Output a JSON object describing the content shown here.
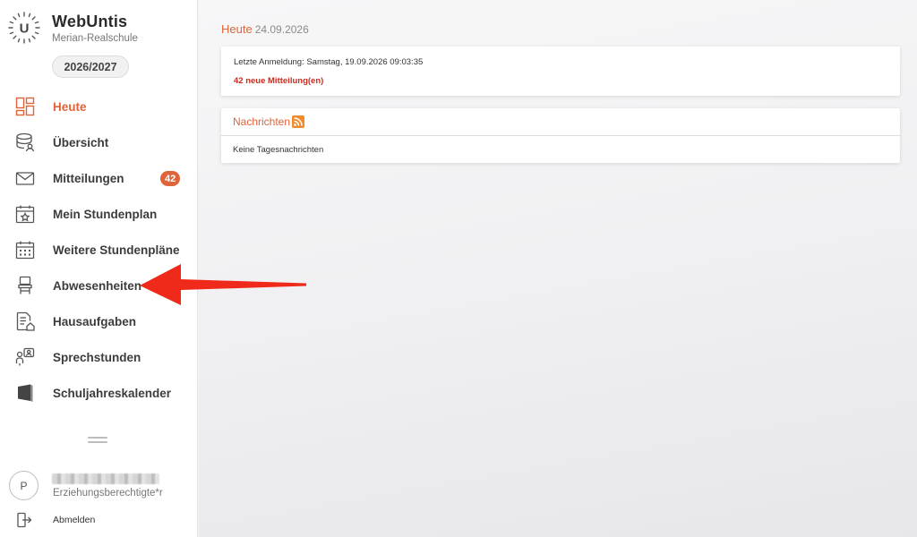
{
  "app": {
    "name": "WebUntis",
    "school": "Merian-Realschule",
    "school_year": "2026/2027",
    "logo_letter": "U"
  },
  "nav": [
    {
      "label": "Heute",
      "icon": "dashboard-icon",
      "active": true
    },
    {
      "label": "Übersicht",
      "icon": "database-icon"
    },
    {
      "label": "Mitteilungen",
      "icon": "envelope-icon",
      "badge": "42"
    },
    {
      "label": "Mein Stundenplan",
      "icon": "calendar-star-icon"
    },
    {
      "label": "Weitere Stundenpläne",
      "icon": "calendar-grid-icon"
    },
    {
      "label": "Abwesenheiten",
      "icon": "chair-icon"
    },
    {
      "label": "Hausaufgaben",
      "icon": "homework-icon"
    },
    {
      "label": "Sprechstunden",
      "icon": "consultation-icon"
    },
    {
      "label": "Schuljahreskalender",
      "icon": "book-calendar-icon"
    }
  ],
  "user": {
    "initial": "P",
    "role": "Erziehungsberechtigte*r"
  },
  "logout": {
    "label": "Abmelden"
  },
  "page": {
    "title": "Heute",
    "date": "24.09.2026",
    "last_login": "Letzte Anmeldung: Samstag, 19.09.2026 09:03:35",
    "new_messages": "42 neue Mitteilung(en)",
    "news_title": "Nachrichten",
    "news_empty": "Keine Tagesnachrichten"
  },
  "colors": {
    "accent": "#e0643a",
    "alert": "#cc2b1e",
    "annotation_arrow": "#f02a1a",
    "rss": "#ef8b2c"
  }
}
